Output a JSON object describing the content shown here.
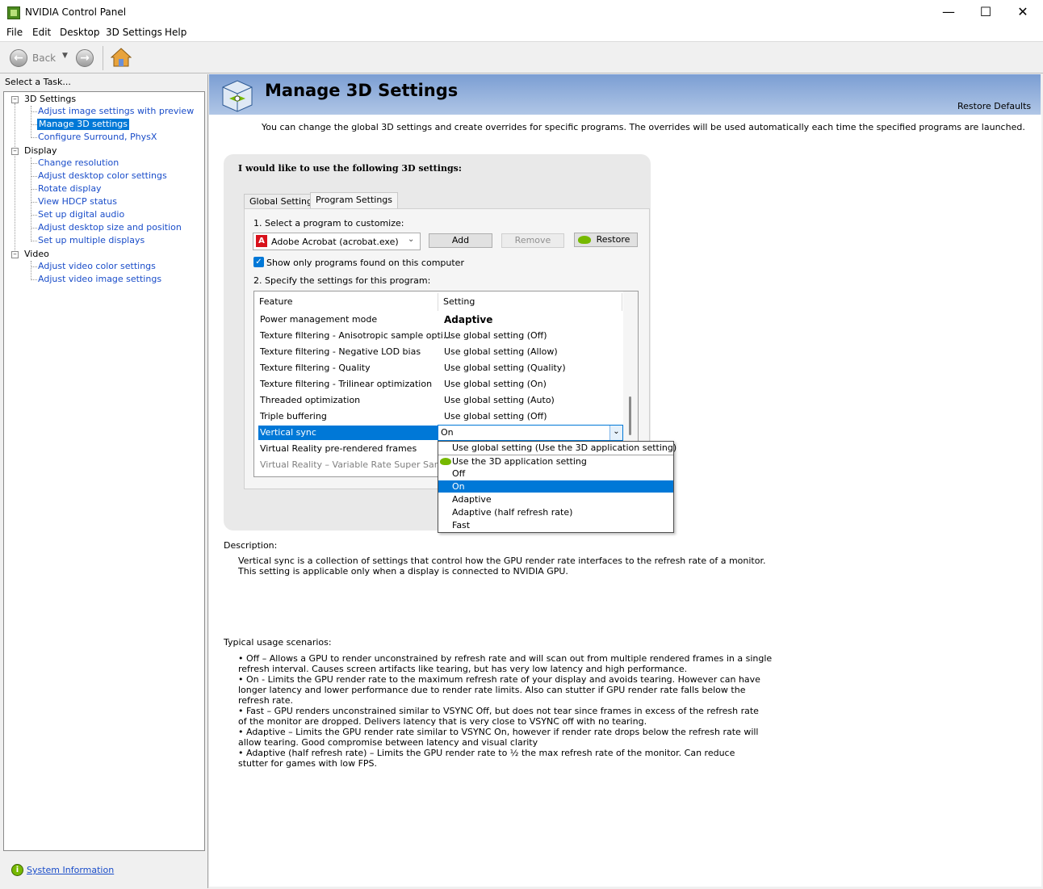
{
  "window": {
    "title": "NVIDIA Control Panel",
    "minimize": "—",
    "maximize": "☐",
    "close": "✕"
  },
  "menu": [
    "File",
    "Edit",
    "Desktop",
    "3D Settings",
    "Help"
  ],
  "toolbar": {
    "back_label": "Back"
  },
  "task_label": "Select a Task...",
  "tree": {
    "sections": [
      {
        "label": "3D Settings",
        "items": [
          "Adjust image settings with preview",
          "Manage 3D settings",
          "Configure Surround, PhysX"
        ]
      },
      {
        "label": "Display",
        "items": [
          "Change resolution",
          "Adjust desktop color settings",
          "Rotate display",
          "View HDCP status",
          "Set up digital audio",
          "Adjust desktop size and position",
          "Set up multiple displays"
        ]
      },
      {
        "label": "Video",
        "items": [
          "Adjust video color settings",
          "Adjust video image settings"
        ]
      }
    ],
    "selected": "Manage 3D settings"
  },
  "system_info": "System Information",
  "header": {
    "title": "Manage 3D Settings",
    "restore_defaults": "Restore Defaults"
  },
  "intro": "You can change the global 3D settings and create overrides for specific programs. The overrides will be used automatically each time the specified programs are launched.",
  "settings": {
    "heading": "I would like to use the following 3D settings:",
    "tabs": [
      "Global Settings",
      "Program Settings"
    ],
    "active_tab": "Program Settings",
    "step1": "1. Select a program to customize:",
    "program": "Adobe Acrobat (acrobat.exe)",
    "add": "Add",
    "remove": "Remove",
    "restore": "Restore",
    "show_only": "Show only programs found on this computer",
    "show_only_checked": true,
    "step2": "2. Specify the settings for this program:",
    "col_feature": "Feature",
    "col_setting": "Setting",
    "rows": [
      {
        "feature": "Power management mode",
        "setting": "Adaptive"
      },
      {
        "feature": "Texture filtering - Anisotropic sample opti...",
        "setting": "Use global setting (Off)"
      },
      {
        "feature": "Texture filtering - Negative LOD bias",
        "setting": "Use global setting (Allow)"
      },
      {
        "feature": "Texture filtering - Quality",
        "setting": "Use global setting (Quality)"
      },
      {
        "feature": "Texture filtering - Trilinear optimization",
        "setting": "Use global setting (On)"
      },
      {
        "feature": "Threaded optimization",
        "setting": "Use global setting (Auto)"
      },
      {
        "feature": "Triple buffering",
        "setting": "Use global setting (Off)"
      },
      {
        "feature": "Vertical sync",
        "setting": "On"
      },
      {
        "feature": "Virtual Reality pre-rendered frames",
        "setting": ""
      },
      {
        "feature": "Virtual Reality – Variable Rate Super Samp...",
        "setting": ""
      }
    ],
    "dropdown_options": [
      "Use global setting (Use the 3D application setting)",
      "Use the 3D application setting",
      "Off",
      "On",
      "Adaptive",
      "Adaptive (half refresh rate)",
      "Fast"
    ],
    "dropdown_selected": "On"
  },
  "description": {
    "label": "Description:",
    "line1": "Vertical sync is a collection of settings that control how the GPU render rate interfaces to the refresh rate of a monitor.",
    "line2": "This setting is applicable only when a display is connected to NVIDIA GPU."
  },
  "usage": {
    "label": "Typical usage scenarios:",
    "lines": [
      "• Off – Allows a GPU to render unconstrained by refresh rate and will scan out from multiple rendered frames in a single",
      "refresh interval. Causes screen artifacts like tearing, but has very low latency and high performance.",
      "• On - Limits the GPU render rate to the maximum refresh rate of your display and avoids tearing. However can have",
      "longer latency and lower performance due to render rate limits. Also can stutter if GPU render rate falls below the",
      "refresh rate.",
      "• Fast – GPU renders unconstrained similar to VSYNC Off, but does not tear since frames in excess of the refresh rate",
      "of the monitor are dropped. Delivers latency that is very close to VSYNC off with no tearing.",
      "• Adaptive – Limits the GPU render rate similar to VSYNC On, however if render rate drops below the refresh rate will",
      "allow tearing. Good compromise between latency and visual clarity",
      "• Adaptive (half refresh rate) – Limits the GPU render rate to ½ the max refresh rate of the monitor. Can reduce",
      "stutter for games with low FPS."
    ]
  },
  "colors": {
    "selection": "#0078d7",
    "link": "#1a4dc9",
    "header_start": "#7b9ed3",
    "nvidia_green": "#76b900"
  }
}
